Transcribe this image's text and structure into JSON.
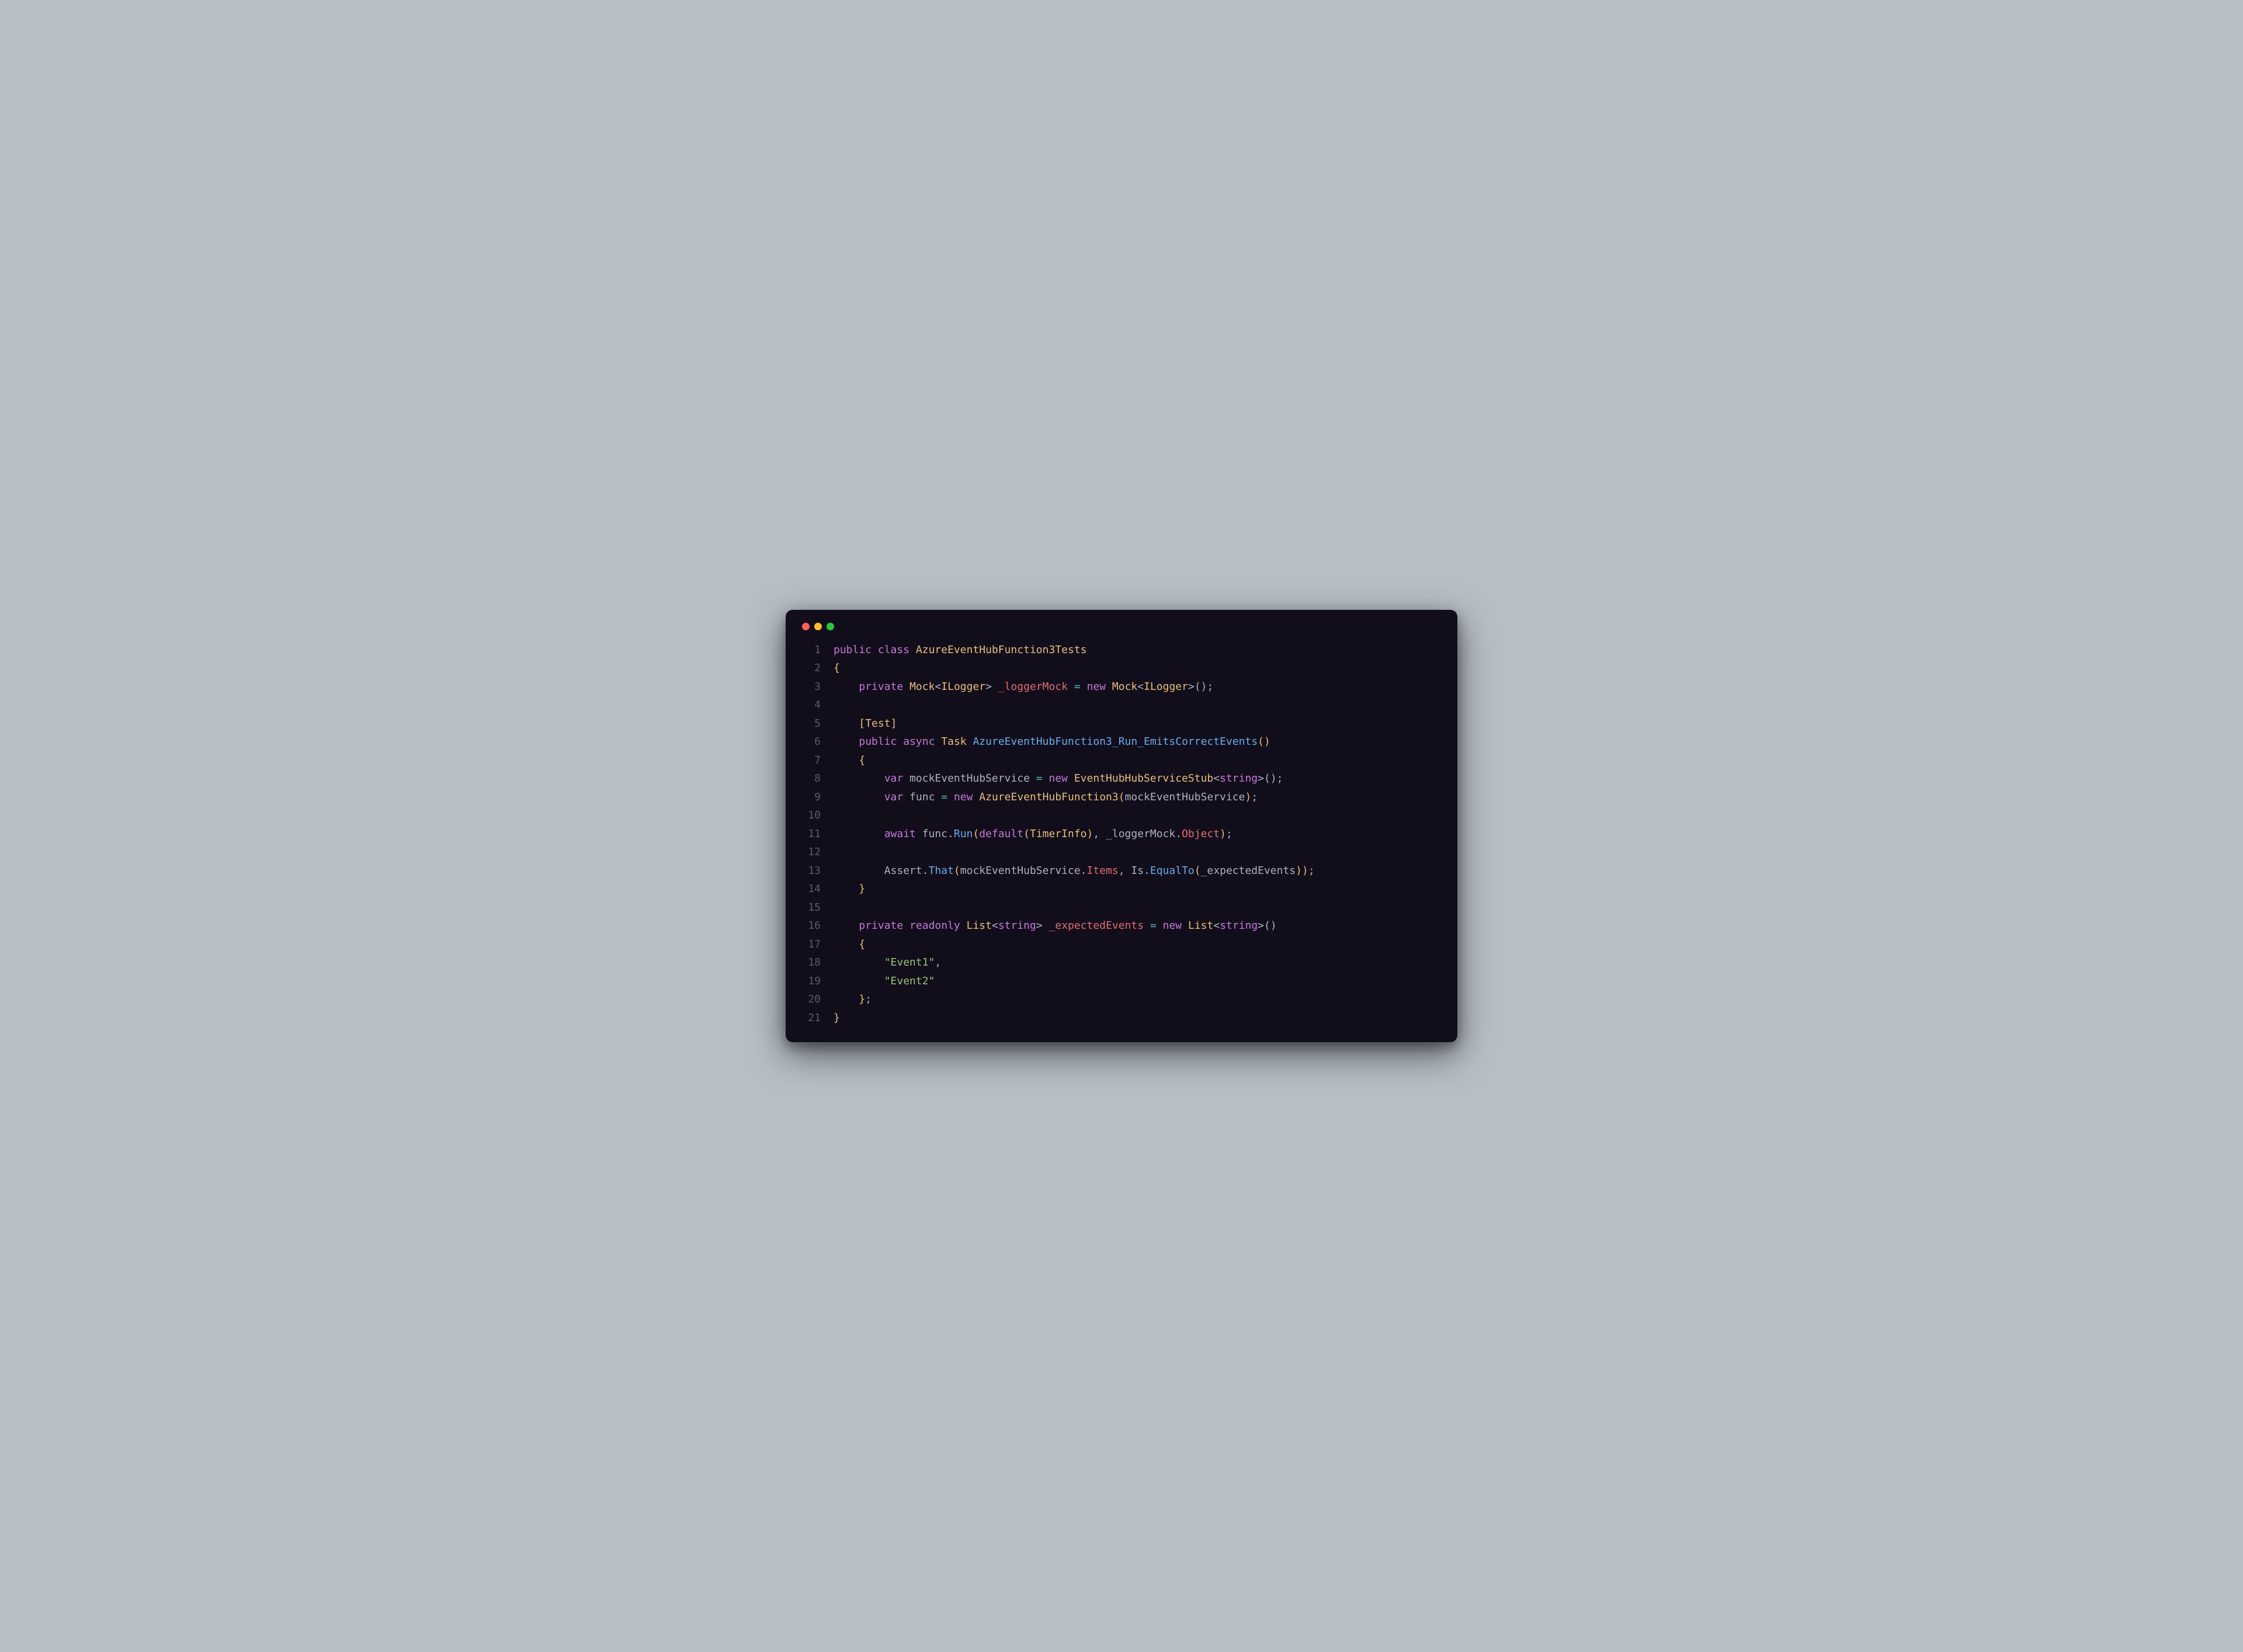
{
  "traffic_lights": [
    "red",
    "yellow",
    "green"
  ],
  "code_lines": [
    {
      "n": 1,
      "tokens": [
        {
          "c": "kw",
          "t": "public"
        },
        {
          "c": "pu",
          "t": " "
        },
        {
          "c": "kw",
          "t": "class"
        },
        {
          "c": "pu",
          "t": " "
        },
        {
          "c": "ty",
          "t": "AzureEventHubFunction3Tests"
        }
      ]
    },
    {
      "n": 2,
      "tokens": [
        {
          "c": "br",
          "t": "{"
        }
      ]
    },
    {
      "n": 3,
      "tokens": [
        {
          "c": "pu",
          "t": "    "
        },
        {
          "c": "kw",
          "t": "private"
        },
        {
          "c": "pu",
          "t": " "
        },
        {
          "c": "ty",
          "t": "Mock"
        },
        {
          "c": "pu",
          "t": "<"
        },
        {
          "c": "ty",
          "t": "ILogger"
        },
        {
          "c": "pu",
          "t": "> "
        },
        {
          "c": "mr",
          "t": "_loggerMock"
        },
        {
          "c": "pu",
          "t": " "
        },
        {
          "c": "cy",
          "t": "="
        },
        {
          "c": "pu",
          "t": " "
        },
        {
          "c": "kw",
          "t": "new"
        },
        {
          "c": "pu",
          "t": " "
        },
        {
          "c": "ty",
          "t": "Mock"
        },
        {
          "c": "pu",
          "t": "<"
        },
        {
          "c": "ty",
          "t": "ILogger"
        },
        {
          "c": "pu",
          "t": ">();"
        }
      ]
    },
    {
      "n": 4,
      "tokens": []
    },
    {
      "n": 5,
      "tokens": [
        {
          "c": "pu",
          "t": "    "
        },
        {
          "c": "br",
          "t": "["
        },
        {
          "c": "ty",
          "t": "Test"
        },
        {
          "c": "br",
          "t": "]"
        }
      ]
    },
    {
      "n": 6,
      "tokens": [
        {
          "c": "pu",
          "t": "    "
        },
        {
          "c": "kw",
          "t": "public"
        },
        {
          "c": "pu",
          "t": " "
        },
        {
          "c": "kw",
          "t": "async"
        },
        {
          "c": "pu",
          "t": " "
        },
        {
          "c": "ty",
          "t": "Task"
        },
        {
          "c": "pu",
          "t": " "
        },
        {
          "c": "tb",
          "t": "AzureEventHubFunction3_Run_EmitsCorrectEvents"
        },
        {
          "c": "br",
          "t": "("
        },
        {
          "c": "br",
          "t": ")"
        }
      ]
    },
    {
      "n": 7,
      "tokens": [
        {
          "c": "pu",
          "t": "    "
        },
        {
          "c": "br",
          "t": "{"
        }
      ]
    },
    {
      "n": 8,
      "tokens": [
        {
          "c": "pu",
          "t": "        "
        },
        {
          "c": "kw",
          "t": "var"
        },
        {
          "c": "pu",
          "t": " mockEventHubService "
        },
        {
          "c": "cy",
          "t": "="
        },
        {
          "c": "pu",
          "t": " "
        },
        {
          "c": "kw",
          "t": "new"
        },
        {
          "c": "pu",
          "t": " "
        },
        {
          "c": "ty",
          "t": "EventHubHubServiceStub"
        },
        {
          "c": "pu",
          "t": "<"
        },
        {
          "c": "kw",
          "t": "string"
        },
        {
          "c": "pu",
          "t": ">();"
        }
      ]
    },
    {
      "n": 9,
      "tokens": [
        {
          "c": "pu",
          "t": "        "
        },
        {
          "c": "kw",
          "t": "var"
        },
        {
          "c": "pu",
          "t": " func "
        },
        {
          "c": "cy",
          "t": "="
        },
        {
          "c": "pu",
          "t": " "
        },
        {
          "c": "kw",
          "t": "new"
        },
        {
          "c": "pu",
          "t": " "
        },
        {
          "c": "ty",
          "t": "AzureEventHubFunction3"
        },
        {
          "c": "br",
          "t": "("
        },
        {
          "c": "pu",
          "t": "mockEventHubService"
        },
        {
          "c": "br",
          "t": ")"
        },
        {
          "c": "pu",
          "t": ";"
        }
      ]
    },
    {
      "n": 10,
      "tokens": []
    },
    {
      "n": 11,
      "tokens": [
        {
          "c": "pu",
          "t": "        "
        },
        {
          "c": "kw",
          "t": "await"
        },
        {
          "c": "pu",
          "t": " func."
        },
        {
          "c": "tb",
          "t": "Run"
        },
        {
          "c": "br",
          "t": "("
        },
        {
          "c": "kw",
          "t": "default"
        },
        {
          "c": "br",
          "t": "("
        },
        {
          "c": "ty",
          "t": "TimerInfo"
        },
        {
          "c": "br",
          "t": ")"
        },
        {
          "c": "pu",
          "t": ", _loggerMock."
        },
        {
          "c": "mr",
          "t": "Object"
        },
        {
          "c": "br",
          "t": ")"
        },
        {
          "c": "pu",
          "t": ";"
        }
      ]
    },
    {
      "n": 12,
      "tokens": []
    },
    {
      "n": 13,
      "tokens": [
        {
          "c": "pu",
          "t": "        Assert."
        },
        {
          "c": "tb",
          "t": "That"
        },
        {
          "c": "br",
          "t": "("
        },
        {
          "c": "pu",
          "t": "mockEventHubService."
        },
        {
          "c": "mr",
          "t": "Items"
        },
        {
          "c": "pu",
          "t": ", Is."
        },
        {
          "c": "tb",
          "t": "EqualTo"
        },
        {
          "c": "br",
          "t": "("
        },
        {
          "c": "pu",
          "t": "_expectedEvents"
        },
        {
          "c": "br",
          "t": ")"
        },
        {
          "c": "br",
          "t": ")"
        },
        {
          "c": "pu",
          "t": ";"
        }
      ]
    },
    {
      "n": 14,
      "tokens": [
        {
          "c": "pu",
          "t": "    "
        },
        {
          "c": "br",
          "t": "}"
        }
      ]
    },
    {
      "n": 15,
      "tokens": []
    },
    {
      "n": 16,
      "tokens": [
        {
          "c": "pu",
          "t": "    "
        },
        {
          "c": "kw",
          "t": "private"
        },
        {
          "c": "pu",
          "t": " "
        },
        {
          "c": "kw",
          "t": "readonly"
        },
        {
          "c": "pu",
          "t": " "
        },
        {
          "c": "ty",
          "t": "List"
        },
        {
          "c": "pu",
          "t": "<"
        },
        {
          "c": "kw",
          "t": "string"
        },
        {
          "c": "pu",
          "t": "> "
        },
        {
          "c": "mr",
          "t": "_expectedEvents"
        },
        {
          "c": "pu",
          "t": " "
        },
        {
          "c": "cy",
          "t": "="
        },
        {
          "c": "pu",
          "t": " "
        },
        {
          "c": "kw",
          "t": "new"
        },
        {
          "c": "pu",
          "t": " "
        },
        {
          "c": "ty",
          "t": "List"
        },
        {
          "c": "pu",
          "t": "<"
        },
        {
          "c": "kw",
          "t": "string"
        },
        {
          "c": "pu",
          "t": ">()"
        }
      ]
    },
    {
      "n": 17,
      "tokens": [
        {
          "c": "pu",
          "t": "    "
        },
        {
          "c": "br",
          "t": "{"
        }
      ]
    },
    {
      "n": 18,
      "tokens": [
        {
          "c": "pu",
          "t": "        "
        },
        {
          "c": "st",
          "t": "\"Event1\""
        },
        {
          "c": "pu",
          "t": ","
        }
      ]
    },
    {
      "n": 19,
      "tokens": [
        {
          "c": "pu",
          "t": "        "
        },
        {
          "c": "st",
          "t": "\"Event2\""
        }
      ]
    },
    {
      "n": 20,
      "tokens": [
        {
          "c": "pu",
          "t": "    "
        },
        {
          "c": "br",
          "t": "}"
        },
        {
          "c": "pu",
          "t": ";"
        }
      ]
    },
    {
      "n": 21,
      "tokens": [
        {
          "c": "br",
          "t": "}"
        }
      ]
    }
  ]
}
